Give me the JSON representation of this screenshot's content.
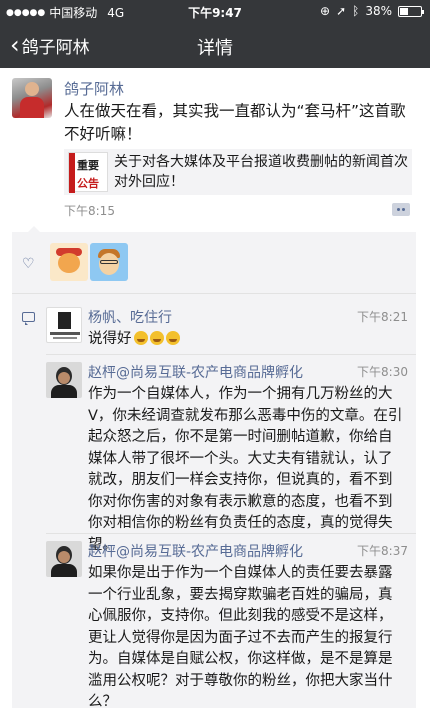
{
  "status_bar": {
    "carrier": "中国移动",
    "network": "4G",
    "time": "下午9:47",
    "battery": "38%",
    "battery_fraction": 0.38
  },
  "nav": {
    "back_label": "鸽子阿林",
    "title": "详情"
  },
  "post": {
    "author": "鸽子阿林",
    "text": "人在做天在看，其实我一直都认为“套马杆”这首歌不好听嘛！",
    "link_card": {
      "thumb_line1": "重要",
      "thumb_line2": "公告",
      "title": "关于对各大媒体及平台报道收费删帖的新闻首次对外回应！"
    },
    "time": "下午8:15"
  },
  "comments": [
    {
      "name": "杨帆、吃住行",
      "time": "下午8:21",
      "text": "说得好"
    },
    {
      "name": "赵枰@尚易互联-农产电商品牌孵化",
      "time": "下午8:30",
      "text": "作为一个自媒体人，作为一个拥有几万粉丝的大V，你未经调查就发布那么恶毒中伤的文章。在引起众怒之后，你不是第一时间删帖道歉，你给自媒体人带了很坏一个头。大丈夫有错就认，认了就改，朋友们一样会支持你，但说真的，看不到你对你伤害的对象有表示歉意的态度，也看不到你对相信你的粉丝有负责任的态度，真的觉得失望。"
    },
    {
      "name": "赵枰@尚易互联-农产电商品牌孵化",
      "time": "下午8:37",
      "text": "如果你是出于作为一个自媒体人的责任要去暴露一个行业乱象，要去揭穿欺骗老百姓的骗局，真心佩服你，支持你。但此刻我的感受不是这样，更让人觉得你是因为面子过不去而产生的报复行为。自媒体是自赋公权，你这样做，是不是算是滥用公权呢？对于尊敬你的粉丝，你把大家当什么？"
    }
  ],
  "icons": {
    "back": "chevron-left-icon",
    "like": "heart-icon",
    "comment": "comment-icon",
    "more": "more-dots-icon"
  },
  "colors": {
    "bar": "#35373a",
    "link": "#576b95",
    "comment_bg": "#f3f3f5"
  }
}
